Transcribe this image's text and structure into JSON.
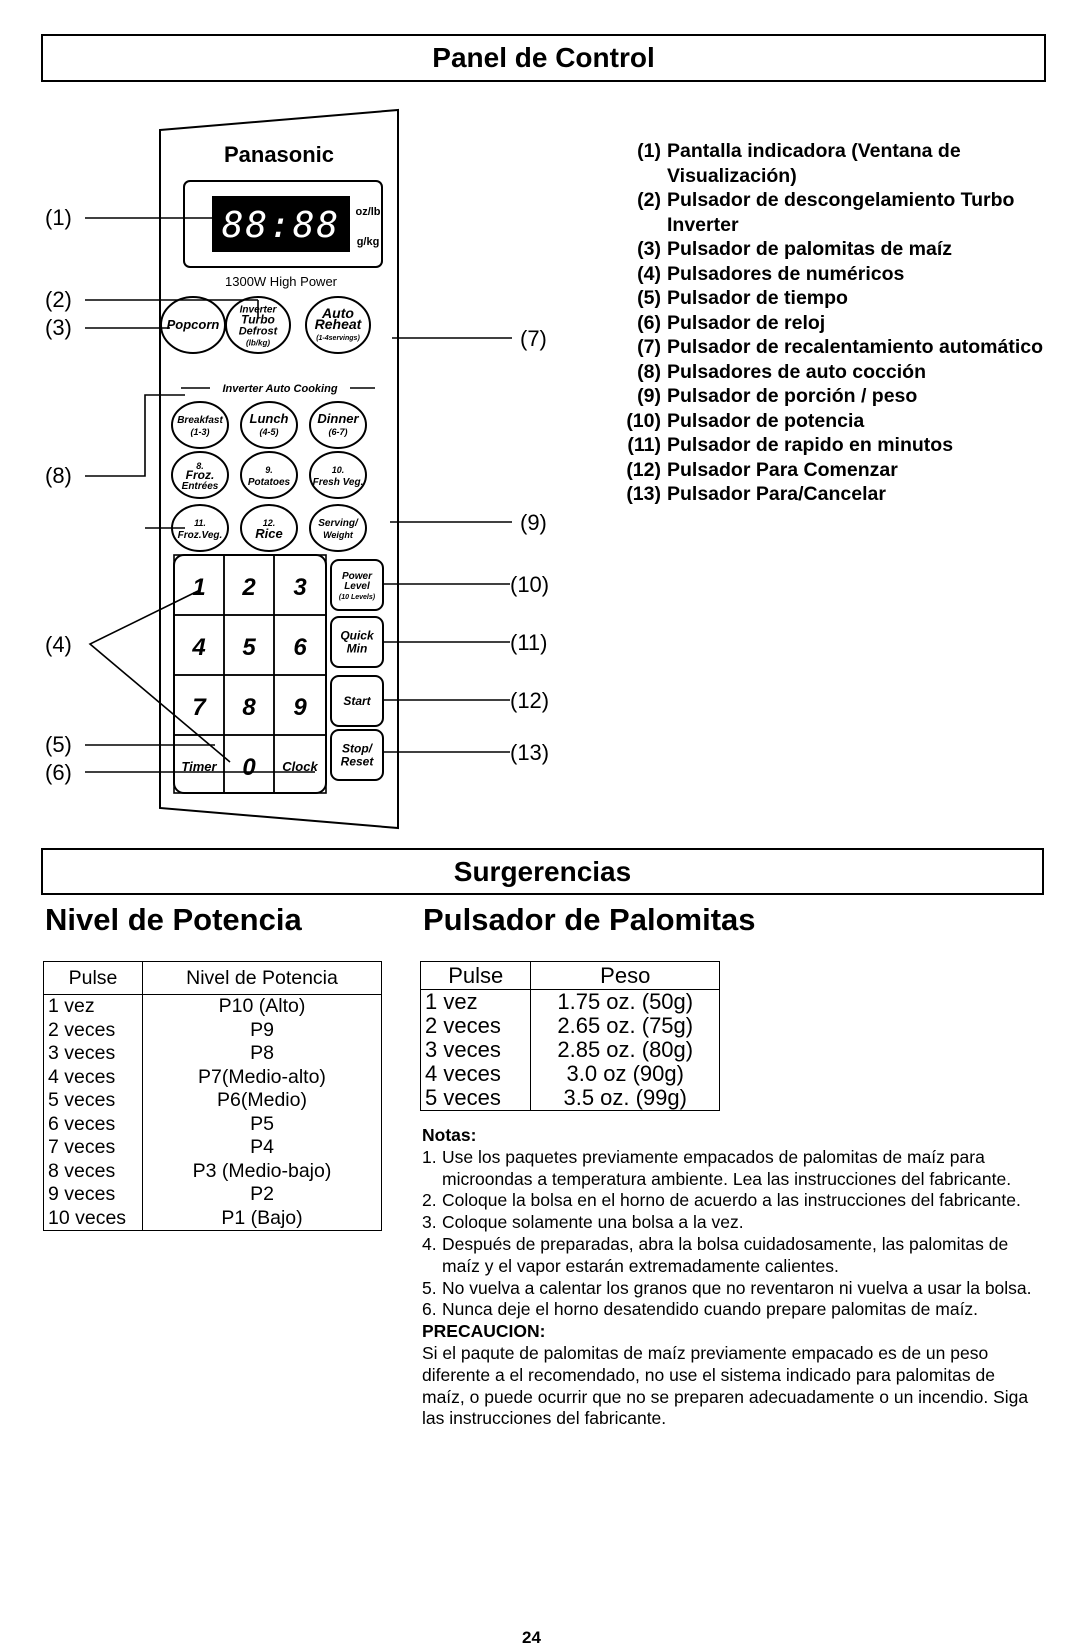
{
  "section1": {
    "title": "Panel de Control"
  },
  "panel": {
    "brand": "Panasonic",
    "display": {
      "digits": "88:88",
      "unit_top": "oz/lb",
      "unit_bottom": "g/kg"
    },
    "power_rating": "1300W High Power",
    "top_buttons": [
      {
        "lines": [
          "Popcorn"
        ]
      },
      {
        "lines": [
          "Inverter",
          "Turbo",
          "Defrost",
          "(lb/kg)"
        ]
      },
      {
        "lines": [
          "Auto",
          "Reheat",
          "(1-4servings)"
        ]
      }
    ],
    "auto_cooking_label": "Inverter Auto Cooking",
    "auto_buttons": [
      {
        "lines": [
          "Breakfast",
          "(1-3)"
        ]
      },
      {
        "lines": [
          "Lunch",
          "(4-5)"
        ]
      },
      {
        "lines": [
          "Dinner",
          "(6-7)"
        ]
      },
      {
        "lines": [
          "8.",
          "Froz.",
          "Entrées"
        ]
      },
      {
        "lines": [
          "9.",
          "Potatoes"
        ]
      },
      {
        "lines": [
          "10.",
          "Fresh Veg."
        ]
      },
      {
        "lines": [
          "11.",
          "Froz.Veg."
        ]
      },
      {
        "lines": [
          "12.",
          "Rice"
        ]
      },
      {
        "lines": [
          "Serving/",
          "Weight"
        ]
      }
    ],
    "keypad": [
      "1",
      "2",
      "3",
      "4",
      "5",
      "6",
      "7",
      "8",
      "9",
      "Timer",
      "0",
      "Clock"
    ],
    "side_buttons": [
      {
        "lines": [
          "Power",
          "Level",
          "(10 Levels)"
        ]
      },
      {
        "lines": [
          "Quick",
          "Min"
        ]
      },
      {
        "lines": [
          "Start"
        ]
      },
      {
        "lines": [
          "Stop/",
          "Reset"
        ]
      }
    ],
    "callouts": [
      "(1)",
      "(2)",
      "(3)",
      "(4)",
      "(5)",
      "(6)",
      "(7)",
      "(8)",
      "(9)",
      "(10)",
      "(11)",
      "(12)",
      "(13)"
    ]
  },
  "legend": [
    {
      "num": "(1)",
      "text": "Pantalla indicadora (Ventana de Visualización)"
    },
    {
      "num": "(2)",
      "text": "Pulsador de descongelamiento Turbo Inverter"
    },
    {
      "num": "(3)",
      "text": "Pulsador de palomitas de maíz"
    },
    {
      "num": "(4)",
      "text": "Pulsadores de numéricos"
    },
    {
      "num": "(5)",
      "text": "Pulsador de tiempo"
    },
    {
      "num": "(6)",
      "text": "Pulsador de reloj"
    },
    {
      "num": "(7)",
      "text": "Pulsador de recalentamiento automático"
    },
    {
      "num": "(8)",
      "text": "Pulsadores de auto cocción"
    },
    {
      "num": "(9)",
      "text": "Pulsador de porción / peso"
    },
    {
      "num": "(10)",
      "text": "Pulsador de potencia"
    },
    {
      "num": "(11)",
      "text": "Pulsador de rapido en minutos"
    },
    {
      "num": "(12)",
      "text": "Pulsador Para Comenzar"
    },
    {
      "num": "(13)",
      "text": "Pulsador Para/Cancelar"
    }
  ],
  "section2": {
    "title": "Surgerencias"
  },
  "power_table": {
    "heading": "Nivel de Potencia",
    "columns": [
      "Pulse",
      "Nivel de Potencia"
    ],
    "rows": [
      [
        "1 vez",
        "P10 (Alto)"
      ],
      [
        "2 veces",
        "P9"
      ],
      [
        "3 veces",
        "P8"
      ],
      [
        "4 veces",
        "P7(Medio-alto)"
      ],
      [
        "5 veces",
        "P6(Medio)"
      ],
      [
        "6 veces",
        "P5"
      ],
      [
        "7 veces",
        "P4"
      ],
      [
        "8 veces",
        "P3 (Medio-bajo)"
      ],
      [
        "9 veces",
        "P2"
      ],
      [
        "10 veces",
        "P1 (Bajo)"
      ]
    ]
  },
  "popcorn_table": {
    "heading": "Pulsador de Palomitas",
    "columns": [
      "Pulse",
      "Peso"
    ],
    "rows": [
      [
        "1 vez",
        "1.75 oz. (50g)"
      ],
      [
        "2 veces",
        "2.65 oz. (75g)"
      ],
      [
        "3 veces",
        "2.85 oz. (80g)"
      ],
      [
        "4 veces",
        "3.0 oz  (90g)"
      ],
      [
        "5 veces",
        "3.5 oz. (99g)"
      ]
    ]
  },
  "notes": {
    "title": "Notas:",
    "items": [
      {
        "n": "1.",
        "text": "Use los paquetes previamente empacados de palomitas de maíz para microondas a temperatura ambiente. Lea las instrucciones del fabricante."
      },
      {
        "n": "2.",
        "text": "Coloque la bolsa en el horno de acuerdo a las instrucciones del fabricante."
      },
      {
        "n": "3.",
        "text": "Coloque solamente una bolsa a la vez."
      },
      {
        "n": "4.",
        "text": "Después de preparadas, abra la bolsa cuidadosamente, las palomitas de maíz y el vapor estarán extremadamente calientes."
      },
      {
        "n": "5.",
        "text": "No vuelva a calentar los granos que no reventaron ni vuelva a usar la bolsa."
      },
      {
        "n": "6.",
        "text": "Nunca deje el horno desatendido cuando prepare palomitas de maíz."
      }
    ],
    "caution_title": "PRECAUCION:",
    "caution_text": "Si el paqute de palomitas de maíz previamente empacado es de un peso diferente a el recomendado, no use el sistema indicado para palomitas de maíz, o puede ocurrir que no se preparen adecuadamente o un incendio. Siga las instrucciones del fabricante."
  },
  "page_number": "24"
}
